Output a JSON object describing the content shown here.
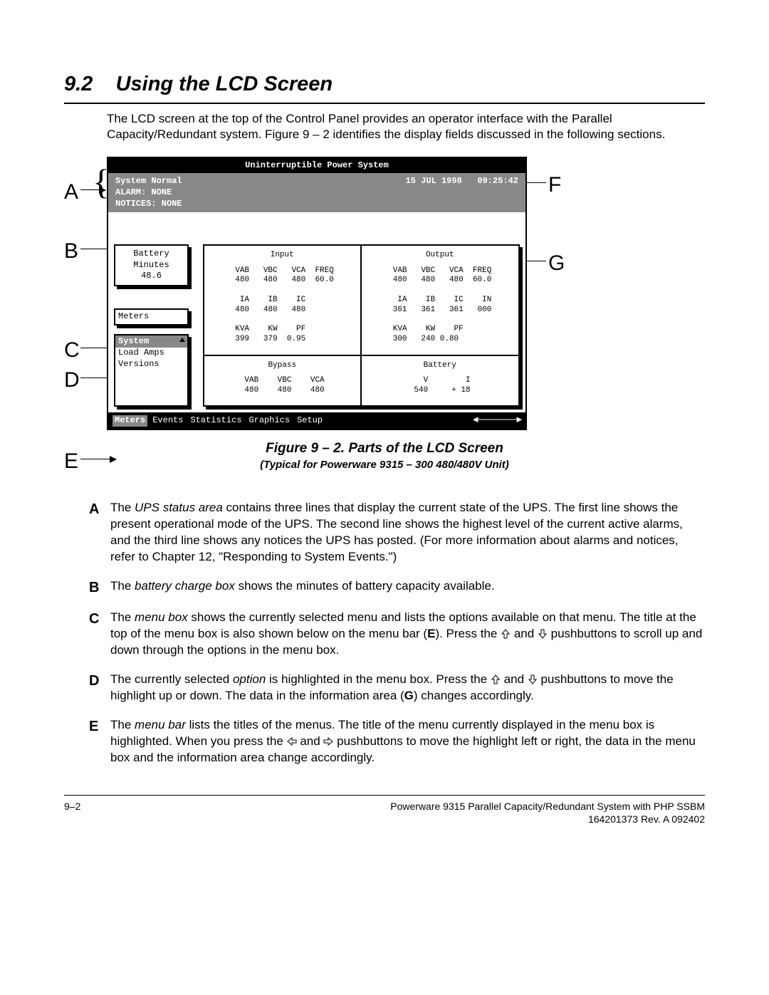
{
  "section": {
    "number": "9.2",
    "title": "Using the LCD Screen"
  },
  "intro": "The LCD screen at the top of the Control Panel provides an operator interface with the Parallel Capacity/Redundant system.  Figure 9 – 2 identifies the display fields discussed in the following sections.",
  "lcd": {
    "header": "Uninterruptible Power System",
    "status": {
      "line1": "System Normal",
      "date": "15 JUL 1998",
      "time": "09:25:42",
      "line2": "ALARM:  NONE",
      "line3": "NOTICES: NONE"
    },
    "battery": {
      "label1": "Battery",
      "label2": "Minutes",
      "value": "48.6"
    },
    "meters_label": "Meters",
    "menu": {
      "title": "System",
      "opt1": "Load Amps",
      "opt2": "Versions"
    },
    "panels": {
      "input": {
        "title": "Input",
        "rows": " VAB   VBC   VCA  FREQ\n 480   480   480  60.0\n\n  IA    IB    IC\n 480   480   480\n\n KVA    KW    PF\n 399   379  0.95"
      },
      "output": {
        "title": "Output",
        "rows": " VAB   VBC   VCA  FREQ\n 480   480   480  60.0\n\n  IA    IB    IC    IN\n 361   361   361   000\n\n KVA    KW    PF\n 300   240 0.80"
      },
      "bypass": {
        "title": "Bypass",
        "rows": " VAB    VBC    VCA\n 480    480    480"
      },
      "battery": {
        "title": "Battery",
        "rows": "   V        I\n 540     + 18"
      }
    },
    "menubar": {
      "m1": "Meters",
      "m2": "Events",
      "m3": "Statistics",
      "m4": "Graphics",
      "m5": "Setup"
    }
  },
  "callouts": {
    "A": "A",
    "B": "B",
    "C": "C",
    "D": "D",
    "E": "E",
    "F": "F",
    "G": "G"
  },
  "figure": {
    "caption": "Figure 9 – 2.   Parts of the LCD Screen",
    "sub": "(Typical for Powerware 9315 – 300 480/480V Unit)"
  },
  "defs": {
    "A": {
      "lead": "The ",
      "term": "UPS status area",
      "rest": " contains three lines that display the current state of the UPS.  The first line shows the present operational mode of the UPS.  The second line shows the highest level of the current active alarms, and the third line shows any notices the UPS has posted.  (For more information about alarms and notices, refer to Chapter 12, \"Responding to System Events.\")"
    },
    "B": {
      "lead": "The ",
      "term": "battery charge box",
      "rest": " shows the minutes of battery capacity available."
    },
    "C": {
      "lead": "The ",
      "term": "menu box",
      "rest": " shows the currently selected menu and lists the options available on that menu.  The title at the top of the menu box is also shown below on the menu bar (",
      "bold1": "E",
      "rest2": ").  Press the ",
      "rest3": " and ",
      "rest4": " pushbuttons to scroll up and down through the options in the menu box."
    },
    "D": {
      "lead": "The currently selected ",
      "term": "option",
      "rest": " is highlighted in the menu box.  Press the ",
      "rest2": " and ",
      "rest3": " pushbuttons to move the highlight up or down. The data in the information area (",
      "bold1": "G",
      "rest4": ") changes accordingly."
    },
    "E": {
      "lead": "The ",
      "term": "menu bar",
      "rest": " lists the titles of the menus.  The title of the menu currently displayed in the menu box is highlighted.  When you press the ",
      "rest2": " and ",
      "rest3": " pushbuttons to move the highlight left or right, the data in the menu box and the information area change accordingly."
    }
  },
  "footer": {
    "page": "9–2",
    "line1": "Powerware 9315 Parallel Capacity/Redundant System with PHP SSBM",
    "line2": "164201373    Rev. A    092402"
  },
  "chart_data": {
    "type": "table",
    "note": "LCD readings shown in figure",
    "input": {
      "VAB": 480,
      "VBC": 480,
      "VCA": 480,
      "FREQ": 60.0,
      "IA": 480,
      "IB": 480,
      "IC": 480,
      "KVA": 399,
      "KW": 379,
      "PF": 0.95
    },
    "output": {
      "VAB": 480,
      "VBC": 480,
      "VCA": 480,
      "FREQ": 60.0,
      "IA": 361,
      "IB": 361,
      "IC": 361,
      "IN": 0,
      "KVA": 300,
      "KW": 240,
      "PF": 0.8
    },
    "bypass": {
      "VAB": 480,
      "VBC": 480,
      "VCA": 480
    },
    "battery_panel": {
      "V": 540,
      "I": 18
    },
    "battery_minutes": 48.6
  }
}
